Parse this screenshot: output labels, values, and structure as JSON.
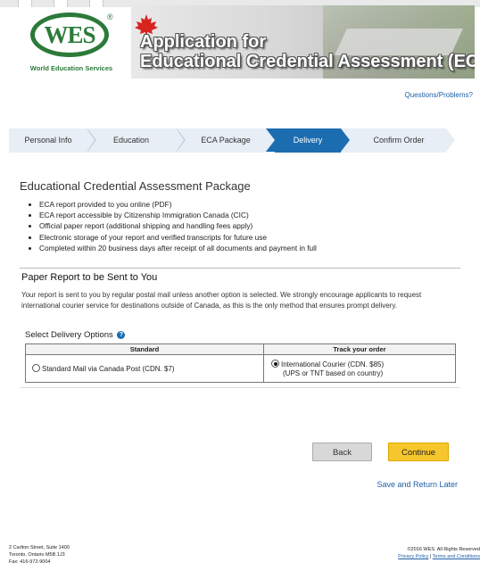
{
  "header": {
    "logo_text": "WES",
    "logo_reg": "®",
    "logo_sub": "World Education Services",
    "title_line1": "Application for",
    "title_line2": "Educational Credential Assessment (ECA)"
  },
  "help_link": "Questions/Problems?",
  "steps": [
    {
      "label": "Personal Info",
      "active": false
    },
    {
      "label": "Education",
      "active": false
    },
    {
      "label": "ECA Package",
      "active": false
    },
    {
      "label": "Delivery",
      "active": true
    },
    {
      "label": "Confirm Order",
      "active": false
    }
  ],
  "package": {
    "title": "Educational Credential Assessment Package",
    "items": [
      "ECA report provided to you online (PDF)",
      "ECA report accessible by Citizenship Immigration Canada (CIC)",
      "Official paper report (additional shipping and handling fees apply)",
      "Electronic storage of your report and verified transcripts for future use",
      "Completed within 20 business days after receipt of all documents and payment in full"
    ]
  },
  "paper": {
    "title": "Paper Report to be Sent to You",
    "description": "Your report is sent to you by regular postal mail unless another option is selected. We strongly encourage applicants to request international courier service for destinations outside of Canada, as this is the only method that ensures prompt delivery."
  },
  "delivery": {
    "label": "Select Delivery Options",
    "col_standard": "Standard",
    "col_track": "Track your order",
    "option_standard": "Standard Mail via Canada Post (CDN. $7)",
    "option_courier": "International Courier (CDN. $85)",
    "option_courier_note": "(UPS or TNT based on country)",
    "selected": "courier"
  },
  "buttons": {
    "back": "Back",
    "continue": "Continue",
    "save": "Save and Return Later"
  },
  "footer": {
    "address1": "2 Carlton Street, Suite 1400",
    "address2": "Toronto, Ontario M5B 1J3",
    "fax": "Fax: 416-972-9004",
    "copyright": "©2016 WES. All Rights Reserved",
    "privacy": "Privacy Policy",
    "divider": "|",
    "terms": "Terms and Conditions"
  },
  "colors": {
    "brand_green": "#2c7a3a",
    "step_active": "#1b6db0",
    "continue_yellow": "#f6c62d",
    "link_blue": "#1f5fa8"
  }
}
